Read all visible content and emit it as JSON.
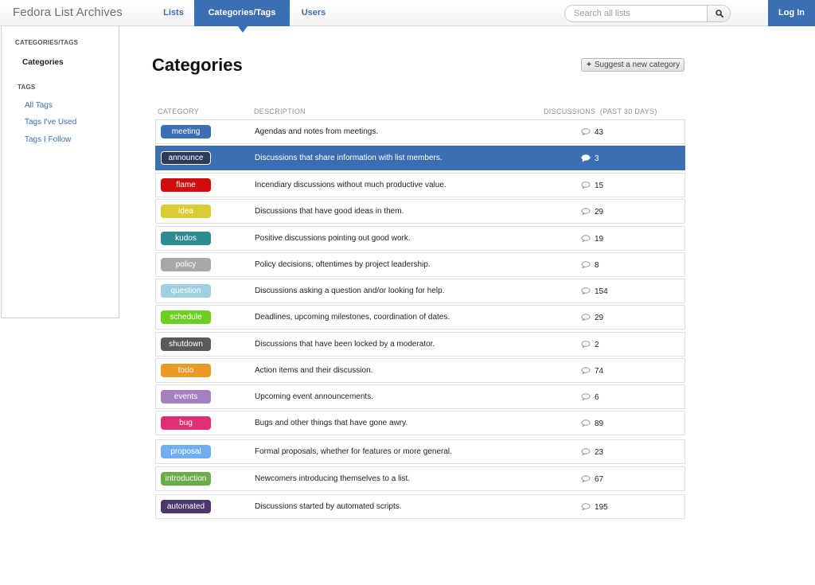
{
  "header": {
    "brand": "Fedora List Archives",
    "nav": {
      "lists": "Lists",
      "categories": "Categories/Tags",
      "users": "Users"
    },
    "search_placeholder": "Search all lists",
    "search_icon": "search-icon",
    "login_label": "Log In",
    "accent_color": "#3c6eb4"
  },
  "sidebar": {
    "heading_categories": "CATEGORIES/TAGS",
    "active_item": "Categories",
    "heading_tags": "TAGS",
    "links": [
      "All Tags",
      "Tags I've Used",
      "Tags I Follow"
    ]
  },
  "main": {
    "title": "Categories",
    "suggest_button": "Suggest a new category",
    "columns": {
      "category": "CATEGORY",
      "description": "DESCRIPTION",
      "discussions": "DISCUSSIONS  (PAST 30 DAYS)"
    },
    "selected_row": "announce",
    "rows": [
      {
        "name": "meeting",
        "color": "#3c6eb4",
        "description": "Agendas and notes from meetings.",
        "count": "43"
      },
      {
        "name": "announce",
        "color": "#2d3a5e",
        "description": "Discussions that share information with list members.",
        "count": "3"
      },
      {
        "name": "flame",
        "color": "#d20b0b",
        "description": "Incendiary discussions without much productive value.",
        "count": "15"
      },
      {
        "name": "idea",
        "color": "#dccc33",
        "description": "Discussions that have good ideas in them.",
        "count": "29"
      },
      {
        "name": "kudos",
        "color": "#2e8c91",
        "description": "Positive discussions pointing out good work.",
        "count": "19"
      },
      {
        "name": "policy",
        "color": "#a7a7ac",
        "description": "Policy decisions, oftentimes by project leadership.",
        "count": "8"
      },
      {
        "name": "question",
        "color": "#9fd0e2",
        "description": "Discussions asking a question and/or looking for help.",
        "count": "154"
      },
      {
        "name": "schedule",
        "color": "#6cd021",
        "description": "Deadlines, upcoming milestones, coordination of dates.",
        "count": "29"
      },
      {
        "name": "shutdown",
        "color": "#5b5b55",
        "description": "Discussions that have been locked by a moderator.",
        "count": "2"
      },
      {
        "name": "todo",
        "color": "#ec9a26",
        "description": "Action items and their discussion.",
        "count": "74"
      },
      {
        "name": "events",
        "color": "#a580bf",
        "description": "Upcoming event announcements.",
        "count": "6"
      },
      {
        "name": "bug",
        "color": "#dd2f72",
        "description": "Bugs and other things that have gone awry.",
        "count": "89"
      },
      {
        "name": "proposal",
        "color": "#70aef0",
        "description": "Formal proposals, whether for features or more general.",
        "count": "23"
      },
      {
        "name": "introduction",
        "color": "#6cab4a",
        "description": "Newcomers introducing themselves to a list.",
        "count": "67"
      },
      {
        "name": "automated",
        "color": "#4d356e",
        "description": "Discussions started by automated scripts.",
        "count": "195"
      }
    ]
  }
}
